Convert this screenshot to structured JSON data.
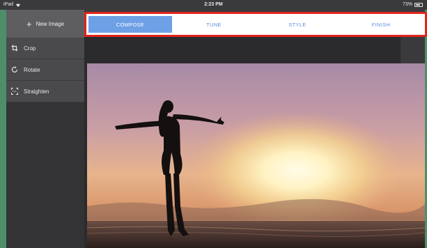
{
  "status_bar": {
    "device": "iPad",
    "time": "2:23 PM",
    "battery": "73%",
    "battery_level": 0.73
  },
  "sidebar": {
    "new_image_label": "New Image",
    "tools": [
      {
        "label": "Crop",
        "icon": "crop-icon"
      },
      {
        "label": "Rotate",
        "icon": "rotate-icon"
      },
      {
        "label": "Straighten",
        "icon": "straighten-icon"
      }
    ]
  },
  "tabs": [
    {
      "label": "COMPOSE",
      "active": true
    },
    {
      "label": "TUNE",
      "active": false
    },
    {
      "label": "STYLE",
      "active": false
    },
    {
      "label": "FINISH",
      "active": false
    }
  ],
  "colors": {
    "accent": "#6ea0e6",
    "highlight_border": "#e0241b",
    "tab_text": "#5b8fe0"
  },
  "image": {
    "subject": "silhouette of woman with arms outstretched at sunset beach"
  }
}
